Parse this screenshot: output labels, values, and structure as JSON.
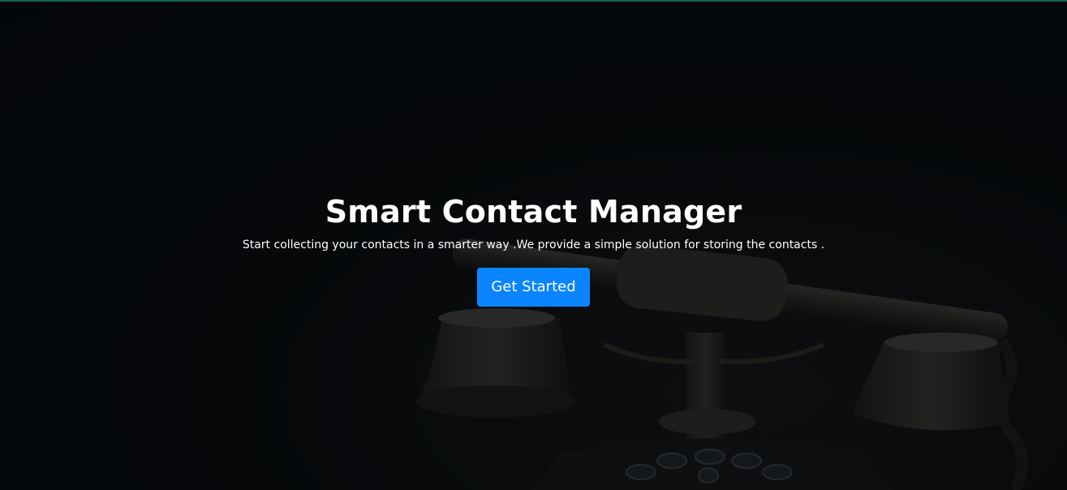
{
  "hero": {
    "title": "Smart Contact Manager",
    "subtitle": "Start collecting your contacts in a smarter way .We provide a simple solution for storing the contacts .",
    "cta_label": "Get Started",
    "background_image": "vintage-telephone-icon"
  },
  "colors": {
    "accent": "#0a84ff",
    "top_border": "#1c9c7c",
    "background": "#05080b",
    "text": "#ffffff"
  }
}
